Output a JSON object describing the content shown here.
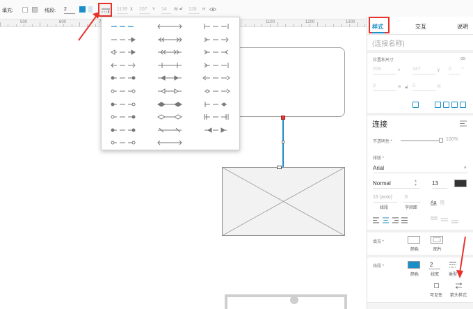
{
  "toolbar": {
    "fill_label": "填充:",
    "line_label": "线段:",
    "line_width": "2",
    "x_value": "1139",
    "x_label": "X",
    "y_value": "207",
    "y_label": "Y",
    "w_value": "14",
    "w_label": "W",
    "h_value": "128",
    "h_label": "H",
    "accent_color": "#1b8ec7"
  },
  "ruler": {
    "labels": [
      "500",
      "600",
      "700",
      "800",
      "900",
      "1000",
      "1100",
      "1200",
      "1300"
    ]
  },
  "arrow_popup": {
    "option_count": 33,
    "selected_index": 0
  },
  "panel": {
    "tabs": [
      "样式",
      "交互",
      "说明"
    ],
    "active_tab": "样式",
    "name_placeholder": "(连接名称)",
    "position_label": "位置和尺寸",
    "pos_x": "209",
    "pos_x_unit": "x",
    "pos_y": "247",
    "pos_y_unit": "y",
    "rotation": "0",
    "rotation_unit": "°",
    "width": "0",
    "width_unit": "w",
    "height": "0",
    "height_unit": "H",
    "section_title": "连接",
    "opacity_label": "不透明性 *",
    "opacity_value": "100%",
    "typography_label": "排版 *",
    "font_family": "Arial",
    "font_weight": "Normal",
    "font_size": "13",
    "line_spacing": "15 (auto)",
    "line_spacing_label": "线段",
    "char_spacing": "0",
    "char_spacing_label": "字间距",
    "fill_label": "填充 *",
    "fill_color_label": "颜色",
    "fill_image_label": "图片",
    "border_label": "线段 *",
    "border_color_label": "颜色",
    "border_width": "2",
    "border_width_label": "线宽",
    "border_type_label": "类型",
    "visibility_label": "可见性",
    "arrow_style_label": "箭头样式"
  }
}
